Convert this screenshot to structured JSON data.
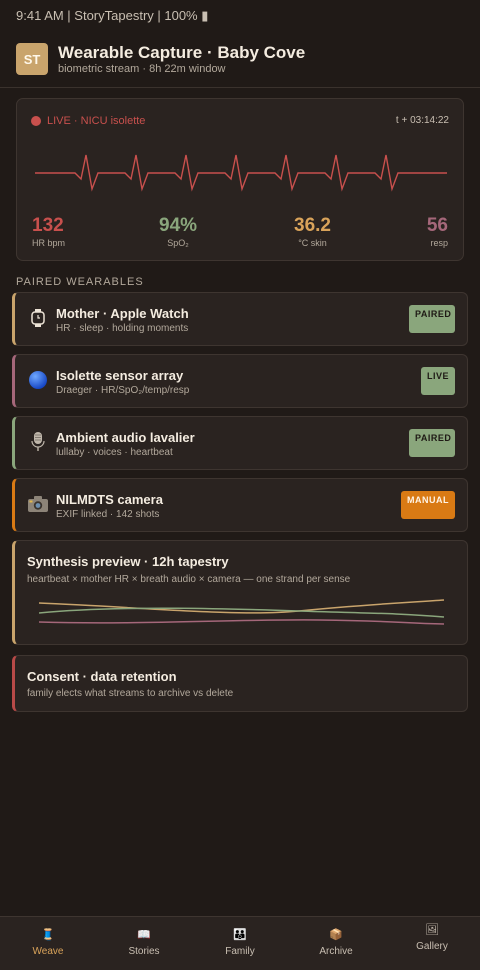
{
  "status_bar": "9:41 AM | StoryTapestry | 100% ▮",
  "header": {
    "avatar_initials": "ST",
    "title": "Wearable Capture · Baby Cove",
    "subtitle": "biometric stream · 8h 22m window"
  },
  "monitor": {
    "live_label": "LIVE · NICU isolette",
    "elapsed": "t + 03:14:22",
    "metrics": [
      {
        "value": "132",
        "label": "HR bpm",
        "color": "#c8504d"
      },
      {
        "value": "94%",
        "label": "SpO₂",
        "color": "#8aa67c"
      },
      {
        "value": "36.2",
        "label": "°C skin",
        "color": "#d9a35a"
      },
      {
        "value": "56",
        "label": "resp",
        "color": "#a5677a"
      }
    ],
    "trace_color": "#c8504d"
  },
  "section_title": "PAIRED WEARABLES",
  "devices": [
    {
      "name": "Mother · Apple Watch",
      "sub": "HR · sleep · holding moments",
      "badge": "PAIRED",
      "icon": "watch-icon",
      "accent": "#c9a46c"
    },
    {
      "name": "Isolette sensor array",
      "sub": "Draeger · HR/SpO₂/temp/resp",
      "badge": "LIVE",
      "icon": "sensor-orb-icon",
      "accent": "#a5677a"
    },
    {
      "name": "Ambient audio lavalier",
      "sub": "lullaby · voices · heartbeat",
      "badge": "PAIRED",
      "icon": "microphone-icon",
      "accent": "#8aa67c"
    },
    {
      "name": "NILMDTS camera",
      "sub": "EXIF linked · 142 shots",
      "badge": "MANUAL",
      "icon": "camera-icon",
      "accent": "#d97a14"
    }
  ],
  "synthesis": {
    "title": "Synthesis preview · 12h tapestry",
    "subtitle": "heartbeat × mother HR × breath audio × camera — one strand per sense",
    "strand_colors": [
      "#c9a46c",
      "#8aa67c",
      "#a5677a"
    ]
  },
  "consent": {
    "title": "Consent · data retention",
    "subtitle": "family elects what streams to archive vs delete"
  },
  "tabs": [
    {
      "label": "Weave",
      "icon": "spool-icon",
      "glyph": "🧵",
      "active": true
    },
    {
      "label": "Stories",
      "icon": "book-icon",
      "glyph": "📖",
      "active": false
    },
    {
      "label": "Family",
      "icon": "family-icon",
      "glyph": "👪",
      "active": false
    },
    {
      "label": "Archive",
      "icon": "box-icon",
      "glyph": "📦",
      "active": false
    },
    {
      "label": "Gallery",
      "icon": "picture-icon",
      "glyph": "🖼",
      "active": false
    }
  ]
}
